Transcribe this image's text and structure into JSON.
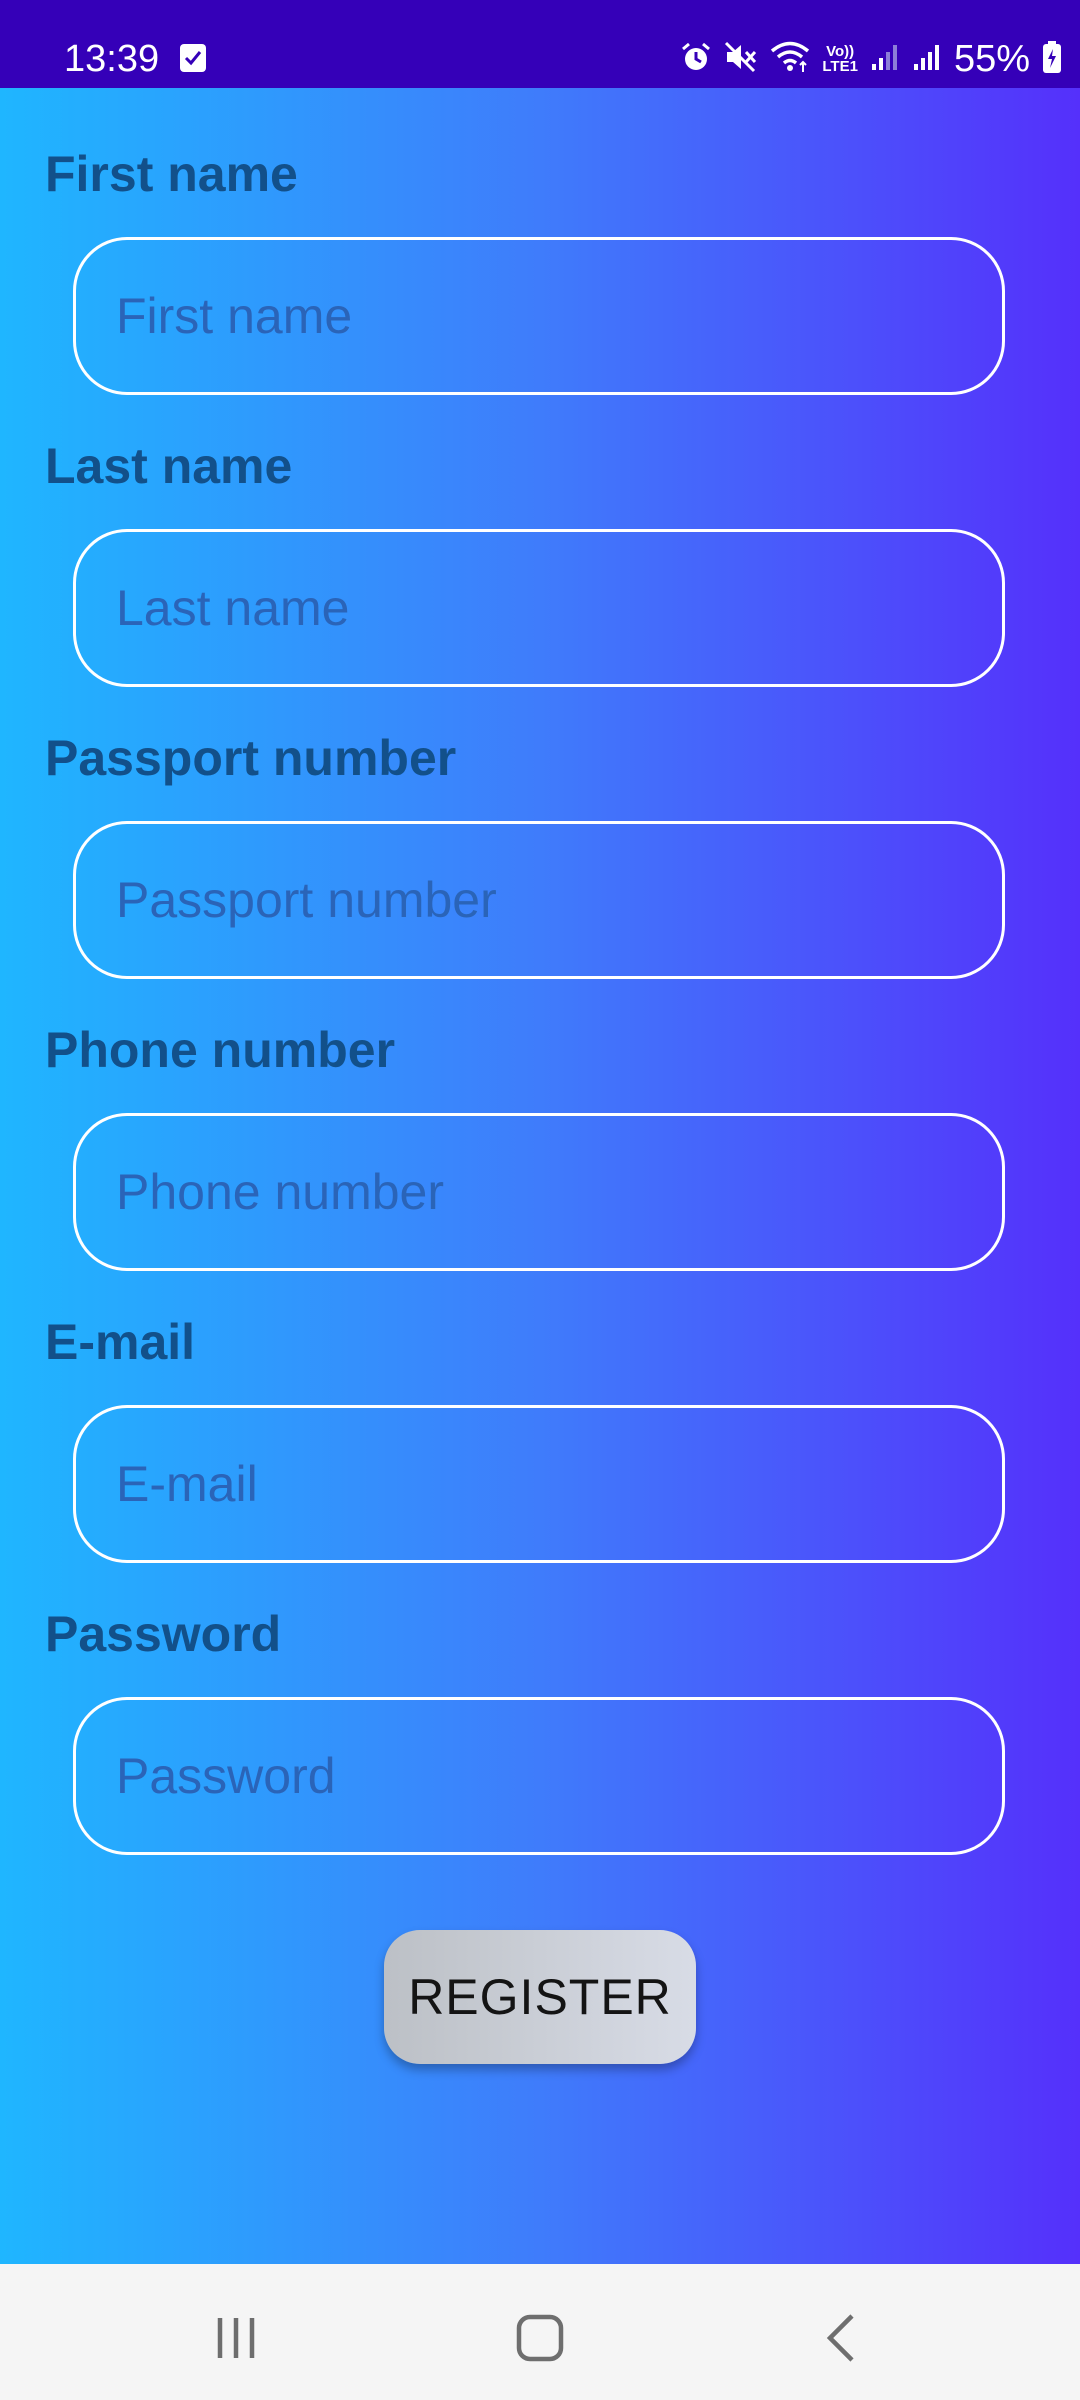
{
  "status_bar": {
    "time": "13:39",
    "battery": "55%",
    "volte_top": "Vo))",
    "volte_bottom": "LTE1",
    "icons": [
      "check-notification-icon",
      "alarm-icon",
      "mute-icon",
      "wifi-icon",
      "volte-icon",
      "signal-icon",
      "signal-icon",
      "battery-charging-icon"
    ]
  },
  "form": {
    "fields": [
      {
        "label": "First name",
        "placeholder": "First name"
      },
      {
        "label": "Last name",
        "placeholder": "Last name"
      },
      {
        "label": "Passport number",
        "placeholder": "Passport number"
      },
      {
        "label": "Phone number",
        "placeholder": "Phone number"
      },
      {
        "label": "E-mail",
        "placeholder": "E-mail"
      },
      {
        "label": "Password",
        "placeholder": "Password"
      }
    ],
    "register_label": "REGISTER"
  },
  "nav_bar": {
    "buttons": [
      "recent-apps-icon",
      "home-icon",
      "back-icon"
    ]
  },
  "colors": {
    "status_bar": "#3500b8",
    "gradient_start": "#1fb6ff",
    "gradient_end": "#5530fb",
    "label": "#12508a",
    "placeholder": "#2a64b8",
    "input_border": "#ffffff"
  }
}
